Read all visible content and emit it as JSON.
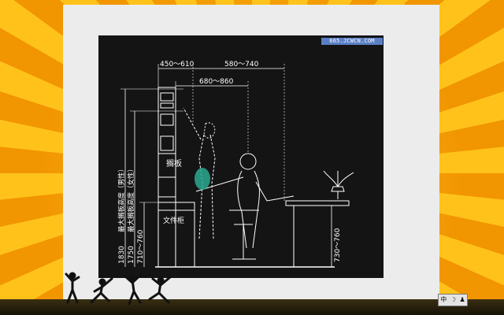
{
  "watermark": "665.JCWCN.COM",
  "ime": {
    "lang": "中",
    "mode_icon": "person-icon"
  },
  "diagram": {
    "dims_top": {
      "a": "450～610",
      "b": "580～740",
      "c": "680～860"
    },
    "dims_left": {
      "a": "1830",
      "b": "1750",
      "c": "710～760"
    },
    "captions_left": {
      "a": "最大搁板高度（男性）",
      "b": "最大搁板高度（女性）"
    },
    "shelf_label": "搁板",
    "cabinet_label": "文件柜",
    "desk_dim": "730～760"
  },
  "colors": {
    "slide_bg": "#ececec",
    "diagram_bg": "#141414",
    "line": "#ffffff",
    "accent_teal": "#2aa890"
  }
}
